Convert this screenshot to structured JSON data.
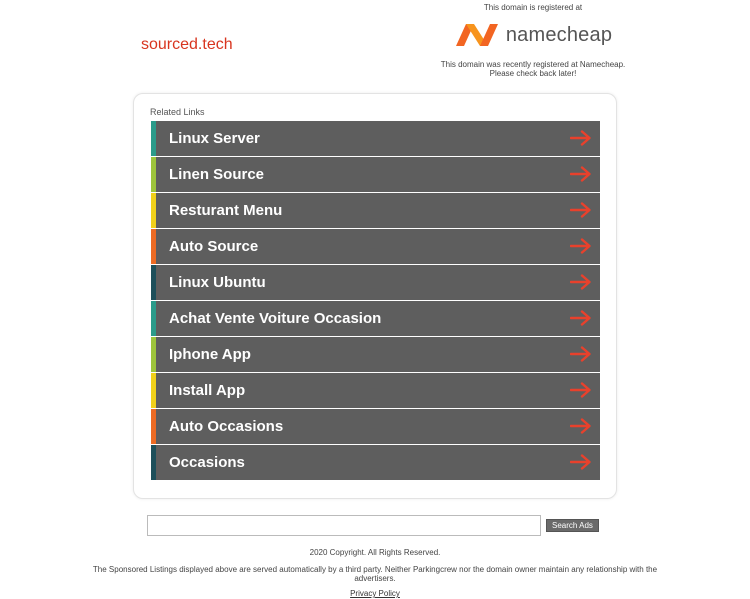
{
  "domain": {
    "name": "sourced.tech"
  },
  "registrar": {
    "top_text": "This domain is registered at",
    "logo_text": "namecheap",
    "note_line1": "This domain was recently registered at Namecheap.",
    "note_line2": "Please check back later!",
    "logo_color": "#f26522"
  },
  "related": {
    "heading": "Related Links",
    "items": [
      {
        "label": "Linux Server",
        "accent": "#2b9b8a"
      },
      {
        "label": "Linen Source",
        "accent": "#9dc43c"
      },
      {
        "label": "Resturant Menu",
        "accent": "#f1d11a"
      },
      {
        "label": "Auto Source",
        "accent": "#ec6b24"
      },
      {
        "label": "Linux Ubuntu",
        "accent": "#1d4f5a"
      },
      {
        "label": "Achat Vente Voiture Occasion",
        "accent": "#2b9b8a"
      },
      {
        "label": "Iphone App",
        "accent": "#9dc43c"
      },
      {
        "label": "Install App",
        "accent": "#f1d11a"
      },
      {
        "label": "Auto Occasions",
        "accent": "#ec6b24"
      },
      {
        "label": "Occasions",
        "accent": "#1d4f5a"
      }
    ],
    "arrow_color": "#e8412c",
    "row_bg": "#5e5e5e"
  },
  "search": {
    "input_value": "",
    "button_label": "Search Ads"
  },
  "footer": {
    "copyright": "2020 Copyright. All Rights Reserved.",
    "disclaimer": "The Sponsored Listings displayed above are served automatically by a third party. Neither Parkingcrew nor the domain owner maintain any relationship with the advertisers.",
    "privacy_label": "Privacy Policy"
  }
}
